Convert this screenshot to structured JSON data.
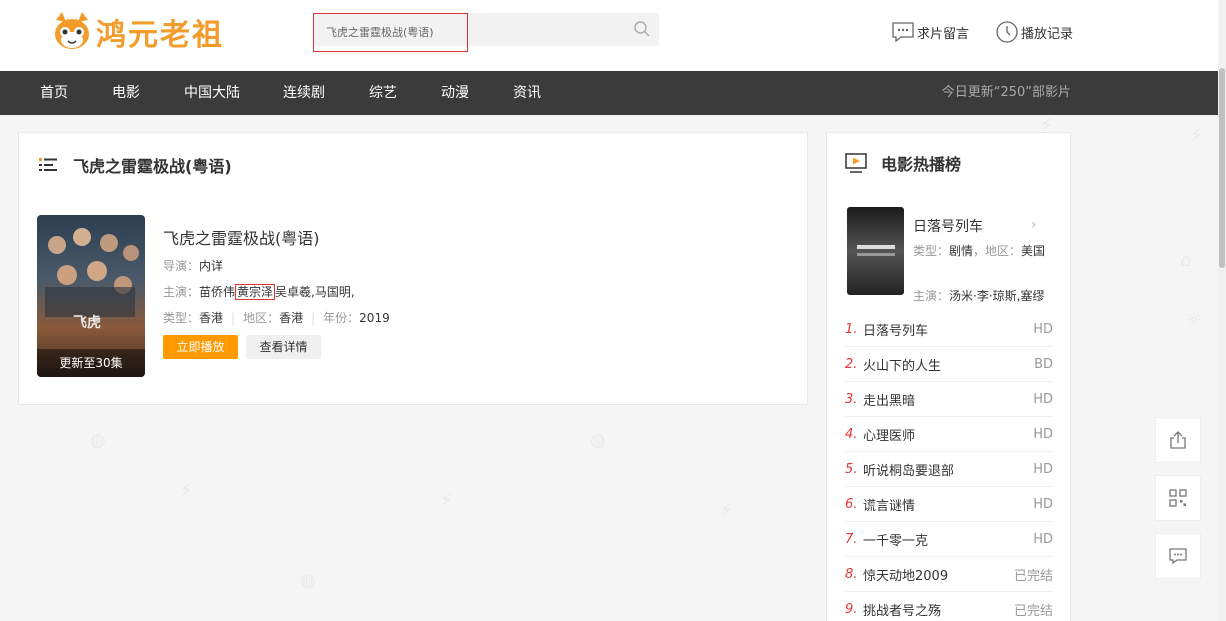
{
  "header": {
    "logo_text": "鸿元老祖",
    "search_value": "飞虎之雷霆极战(粤语)",
    "request_label": "求片留言",
    "history_label": "播放记录"
  },
  "nav": {
    "items": [
      "首页",
      "电影",
      "中国大陆",
      "连续剧",
      "综艺",
      "动漫",
      "资讯"
    ],
    "update_note": "今日更新“250”部影片"
  },
  "main": {
    "section_title": "飞虎之雷霆极战(粤语)",
    "poster_badge": "更新至30集",
    "title": "飞虎之雷霆极战(粤语)",
    "director_label": "导演：",
    "director": "内详",
    "actors_label": "主演：",
    "actor_1": "苗侨伟",
    "actor_2": "黄宗泽",
    "actor_rest": "吴卓羲,马国明,",
    "type_label": "类型：",
    "type": "香港",
    "region_label": "地区：",
    "region": "香港",
    "year_label": "年份：",
    "year": "2019",
    "play_button": "立即播放",
    "detail_button": "查看详情"
  },
  "side": {
    "title": "电影热播榜",
    "featured": {
      "title": "日落号列车",
      "type_label": "类型：",
      "type": "剧情",
      "region_label": "，地区：",
      "region": "美国",
      "actors_label": "主演：",
      "actors": "汤米·李·琼斯,塞缪"
    },
    "ranks": [
      {
        "num": "1.",
        "name": "日落号列车",
        "tag": "HD"
      },
      {
        "num": "2.",
        "name": "火山下的人生",
        "tag": "BD"
      },
      {
        "num": "3.",
        "name": "走出黑暗",
        "tag": "HD"
      },
      {
        "num": "4.",
        "name": "心理医师",
        "tag": "HD"
      },
      {
        "num": "5.",
        "name": "听说桐岛要退部",
        "tag": "HD"
      },
      {
        "num": "6.",
        "name": "谎言谜情",
        "tag": "HD"
      },
      {
        "num": "7.",
        "name": "一千零一克",
        "tag": "HD"
      },
      {
        "num": "8.",
        "name": "惊天动地2009",
        "tag": "已完结"
      },
      {
        "num": "9.",
        "name": "挑战者号之殇",
        "tag": "已完结"
      }
    ]
  },
  "colors": {
    "accent": "#ff9900",
    "nav_bg": "#3b3b3b",
    "rank_num": "#e33333",
    "logo": "#f39c2b"
  }
}
